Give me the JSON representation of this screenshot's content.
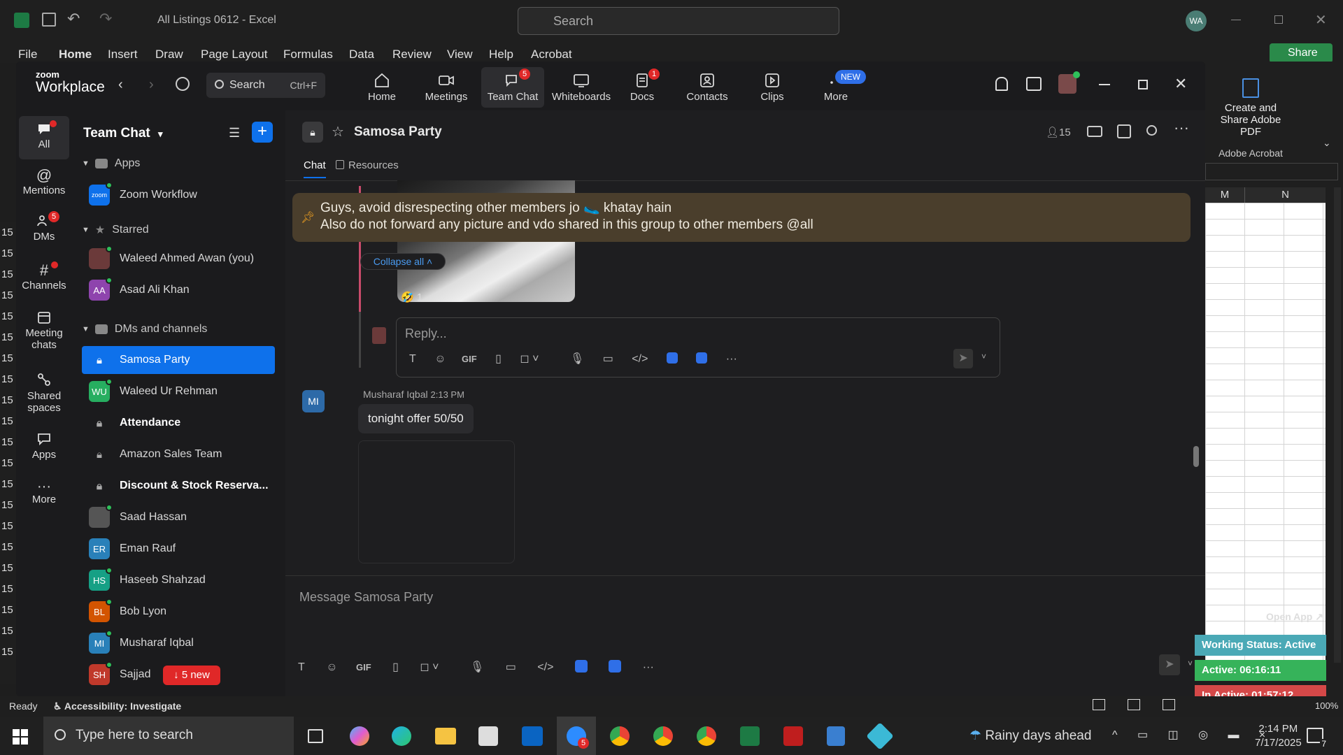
{
  "excel": {
    "title": "All Listings 0612  -  Excel",
    "search_placeholder": "Search",
    "user_initials": "WA",
    "tabs": [
      "File",
      "Home",
      "Insert",
      "Draw",
      "Page Layout",
      "Formulas",
      "Data",
      "Review",
      "View",
      "Help",
      "Acrobat"
    ],
    "share_label": "Share",
    "acrobat_title": "Create and Share Adobe PDF",
    "acrobat_group": "Adobe Acrobat",
    "col_m": "M",
    "col_n": "N",
    "row_label": "15",
    "status_ready": "Ready",
    "accessibility": "Accessibility: Investigate",
    "zoom_pct": "100%"
  },
  "zoom": {
    "brand_top": "zoom",
    "brand_bottom": "Workplace",
    "search_label": "Search",
    "search_shortcut": "Ctrl+F",
    "nav": [
      {
        "label": "Home",
        "badge": ""
      },
      {
        "label": "Meetings",
        "badge": ""
      },
      {
        "label": "Team Chat",
        "badge": "5"
      },
      {
        "label": "Whiteboards",
        "badge": ""
      },
      {
        "label": "Docs",
        "badge": "1"
      },
      {
        "label": "Contacts",
        "badge": ""
      },
      {
        "label": "Clips",
        "badge": ""
      },
      {
        "label": "More",
        "badge": "NEW"
      }
    ],
    "rail": [
      {
        "label": "All"
      },
      {
        "label": "Mentions"
      },
      {
        "label": "DMs",
        "badge": "5"
      },
      {
        "label": "Channels"
      },
      {
        "label": "Meeting chats"
      },
      {
        "label": "Shared spaces"
      },
      {
        "label": "Apps"
      },
      {
        "label": "More"
      }
    ],
    "sidebar": {
      "title": "Team Chat",
      "sections": {
        "apps": "Apps",
        "starred": "Starred",
        "dms": "DMs and channels"
      },
      "items": [
        {
          "label": "Zoom Workflow",
          "initials": "zoom",
          "color": "#0e71eb"
        },
        {
          "label": "Waleed Ahmed Awan (you)",
          "initials": "",
          "color": "#6b3a3a"
        },
        {
          "label": "Asad Ali Khan",
          "initials": "AA",
          "color": "#8e44ad"
        },
        {
          "label": "Samosa Party",
          "initials": "",
          "color": ""
        },
        {
          "label": "Waleed Ur Rehman",
          "initials": "WU",
          "color": "#27ae60"
        },
        {
          "label": "Attendance",
          "initials": "",
          "color": ""
        },
        {
          "label": "Amazon Sales Team",
          "initials": "",
          "color": ""
        },
        {
          "label": "Discount & Stock Reserva...",
          "initials": "",
          "color": ""
        },
        {
          "label": "Saad Hassan",
          "initials": "",
          "color": "#555"
        },
        {
          "label": "Eman Rauf",
          "initials": "ER",
          "color": "#2980b9"
        },
        {
          "label": "Haseeb Shahzad",
          "initials": "HS",
          "color": "#16a085"
        },
        {
          "label": "Bob Lyon",
          "initials": "BL",
          "color": "#d35400"
        },
        {
          "label": "Musharaf Iqbal",
          "initials": "MI",
          "color": "#2980b9"
        },
        {
          "label": "Sajjad",
          "initials": "SH",
          "color": "#c0392b"
        }
      ],
      "new_pill": "5 new"
    },
    "chat": {
      "channel": "Samosa Party",
      "member_count": "15",
      "tabs": [
        "Chat",
        "Resources"
      ],
      "pinned_line1": "Guys, avoid disrespecting other members jo 🥿 khatay hain",
      "pinned_line2": "Also do not forward any picture and vdo shared in this group to other members @all",
      "collapse_all": "Collapse all",
      "reaction_count": "1",
      "reply_placeholder": "Reply...",
      "sender_initials": "MI",
      "sender": "Musharaf Iqbal",
      "time": "2:13 PM",
      "message": "tonight offer 50/50",
      "composer_placeholder": "Message Samosa Party",
      "gif": "GIF"
    }
  },
  "widget": {
    "open_app": "Open App",
    "working_status": "Working Status: Active",
    "active": "Active: 06:16:11",
    "inactive": "In Active: 01:57:12"
  },
  "taskbar": {
    "search_placeholder": "Type here to search",
    "weather": "Rainy days ahead",
    "time": "2:14 PM",
    "date": "7/17/2025",
    "notif_count": "7",
    "zoom_badge": "5"
  }
}
